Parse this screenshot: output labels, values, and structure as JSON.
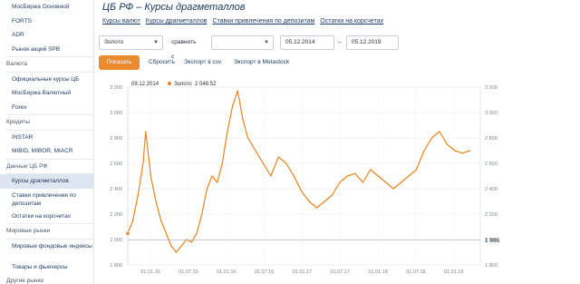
{
  "sidebar": {
    "items": [
      {
        "label": "МосБиржа Основной",
        "kind": "link"
      },
      {
        "label": "FORTS",
        "kind": "link"
      },
      {
        "label": "ADR",
        "kind": "link"
      },
      {
        "label": "Рынок акций SPB",
        "kind": "link"
      },
      {
        "label": "Валюта",
        "kind": "section"
      },
      {
        "label": "Официальные курсы ЦБ",
        "kind": "link"
      },
      {
        "label": "МосБиржа Валютный",
        "kind": "link"
      },
      {
        "label": "Forex",
        "kind": "link"
      },
      {
        "label": "Кредиты",
        "kind": "section"
      },
      {
        "label": "INSTAR",
        "kind": "link"
      },
      {
        "label": "MIBID, MIBOR, MIACR",
        "kind": "link"
      },
      {
        "label": "Данные ЦБ РФ",
        "kind": "section"
      },
      {
        "label": "Курсы драгметаллов",
        "kind": "active"
      },
      {
        "label": "Ставки привлечения по депозитам",
        "kind": "link-2"
      },
      {
        "label": "Остатки на корсчетах",
        "kind": "link"
      },
      {
        "label": "Мировые рынки",
        "kind": "section"
      },
      {
        "label": "Мировые фондовые индексы",
        "kind": "link-2"
      },
      {
        "label": "Товары и фьючерсы",
        "kind": "link"
      },
      {
        "label": "Другие рынки",
        "kind": "section"
      }
    ]
  },
  "page": {
    "title": "ЦБ РФ – Курсы драгметаллов"
  },
  "tabs": [
    {
      "label": "Курсы валют"
    },
    {
      "label": "Курсы драгметаллов"
    },
    {
      "label": "Ставки привлечения по депозитам"
    },
    {
      "label": "Остатки на корсчетах"
    }
  ],
  "controls": {
    "metal": "Золото",
    "compare_label": "сравнить с",
    "compare_value": "",
    "date_from": "05.12.2014",
    "date_sep": "–",
    "date_to": "05.12.2019"
  },
  "actions": {
    "show": "Показать",
    "reset": "Сбросить",
    "export_csv": "Экспорт в csv",
    "export_metastock": "Экспорт в Metastock"
  },
  "colors": {
    "accent": "#ec8a2e",
    "line": "#e8841e",
    "link": "#1f3f6b"
  },
  "chart_data": {
    "type": "line",
    "tooltip": {
      "date": "09.12.2014",
      "series": "Золото",
      "value": "2 048.52"
    },
    "last_value_label": "1 996",
    "ylim": [
      1800,
      3200
    ],
    "y_ticks": [
      1800,
      2000,
      2200,
      2400,
      2600,
      2800,
      3000,
      3200
    ],
    "y_tick_labels": [
      "1 800",
      "2 000",
      "2 200",
      "2 400",
      "2 600",
      "2 800",
      "3 000",
      "3 200"
    ],
    "x_tick_labels": [
      "01.01.15",
      "01.07.15",
      "01.01.16",
      "01.07.16",
      "01.01.17",
      "01.07.17",
      "01.01.18",
      "01.07.18",
      "01.01.19"
    ],
    "grid": true,
    "series": [
      {
        "name": "Золото",
        "points": [
          [
            0.0,
            2048
          ],
          [
            0.02,
            2150
          ],
          [
            0.04,
            2350
          ],
          [
            0.06,
            2600
          ],
          [
            0.07,
            2850
          ],
          [
            0.09,
            2500
          ],
          [
            0.11,
            2300
          ],
          [
            0.13,
            2150
          ],
          [
            0.15,
            2050
          ],
          [
            0.17,
            1950
          ],
          [
            0.19,
            1900
          ],
          [
            0.21,
            1950
          ],
          [
            0.23,
            2000
          ],
          [
            0.25,
            1980
          ],
          [
            0.27,
            2050
          ],
          [
            0.29,
            2200
          ],
          [
            0.31,
            2400
          ],
          [
            0.33,
            2500
          ],
          [
            0.35,
            2450
          ],
          [
            0.37,
            2600
          ],
          [
            0.39,
            2850
          ],
          [
            0.41,
            3050
          ],
          [
            0.43,
            3170
          ],
          [
            0.45,
            2950
          ],
          [
            0.47,
            2800
          ],
          [
            0.5,
            2700
          ],
          [
            0.53,
            2600
          ],
          [
            0.56,
            2500
          ],
          [
            0.59,
            2650
          ],
          [
            0.62,
            2600
          ],
          [
            0.65,
            2500
          ],
          [
            0.68,
            2380
          ],
          [
            0.71,
            2300
          ],
          [
            0.74,
            2250
          ],
          [
            0.77,
            2300
          ],
          [
            0.8,
            2350
          ],
          [
            0.83,
            2450
          ],
          [
            0.86,
            2500
          ],
          [
            0.89,
            2520
          ],
          [
            0.92,
            2450
          ],
          [
            0.95,
            2550
          ],
          [
            0.98,
            2500
          ],
          [
            1.01,
            2450
          ],
          [
            1.04,
            2400
          ],
          [
            1.07,
            2450
          ],
          [
            1.1,
            2500
          ],
          [
            1.13,
            2550
          ],
          [
            1.16,
            2700
          ],
          [
            1.19,
            2800
          ],
          [
            1.22,
            2850
          ],
          [
            1.25,
            2750
          ],
          [
            1.28,
            2700
          ],
          [
            1.31,
            2680
          ],
          [
            1.34,
            2700
          ]
        ]
      }
    ]
  }
}
